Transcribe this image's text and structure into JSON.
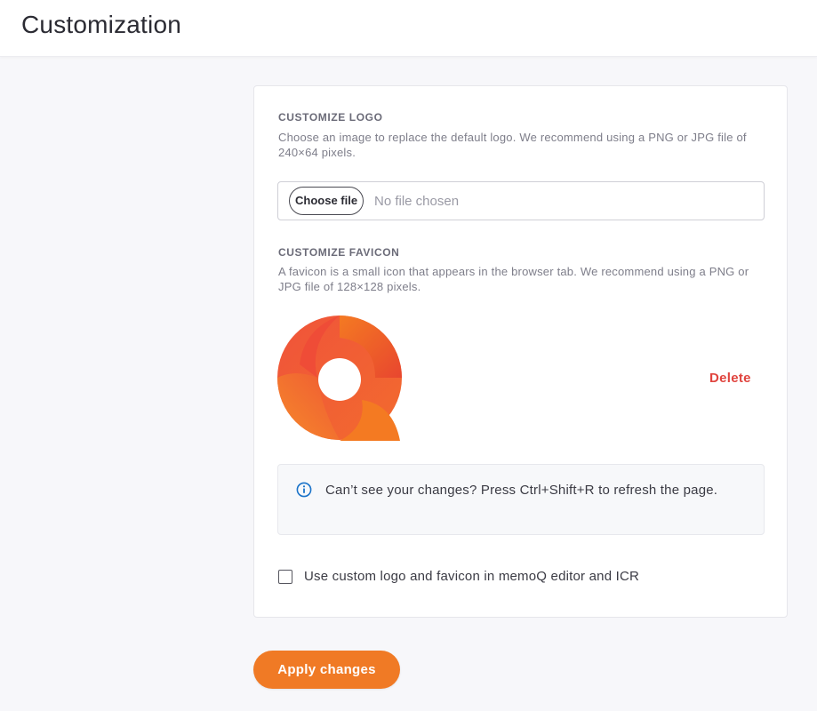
{
  "header": {
    "title": "Customization"
  },
  "logo_section": {
    "heading": "CUSTOMIZE LOGO",
    "description": "Choose an image to replace the default logo. We recommend using a PNG or JPG file of 240×64 pixels.",
    "choose_file_label": "Choose file",
    "no_file_text": "No file chosen"
  },
  "favicon_section": {
    "heading": "CUSTOMIZE FAVICON",
    "description": "A favicon is a small icon that appears in the browser tab. We recommend using a PNG or JPG file of 128×128 pixels.",
    "preview_icon": "memoq-logo-icon",
    "delete_label": "Delete"
  },
  "info": {
    "icon": "info-icon",
    "text": "Can’t see your changes? Press Ctrl+Shift+R to refresh the page."
  },
  "option": {
    "checkbox_label": "Use custom logo and favicon in memoQ editor and ICR",
    "checked": false
  },
  "actions": {
    "apply_label": "Apply changes"
  },
  "colors": {
    "accent": "#f07a25",
    "danger": "#e0443e",
    "info": "#1a73c9"
  }
}
